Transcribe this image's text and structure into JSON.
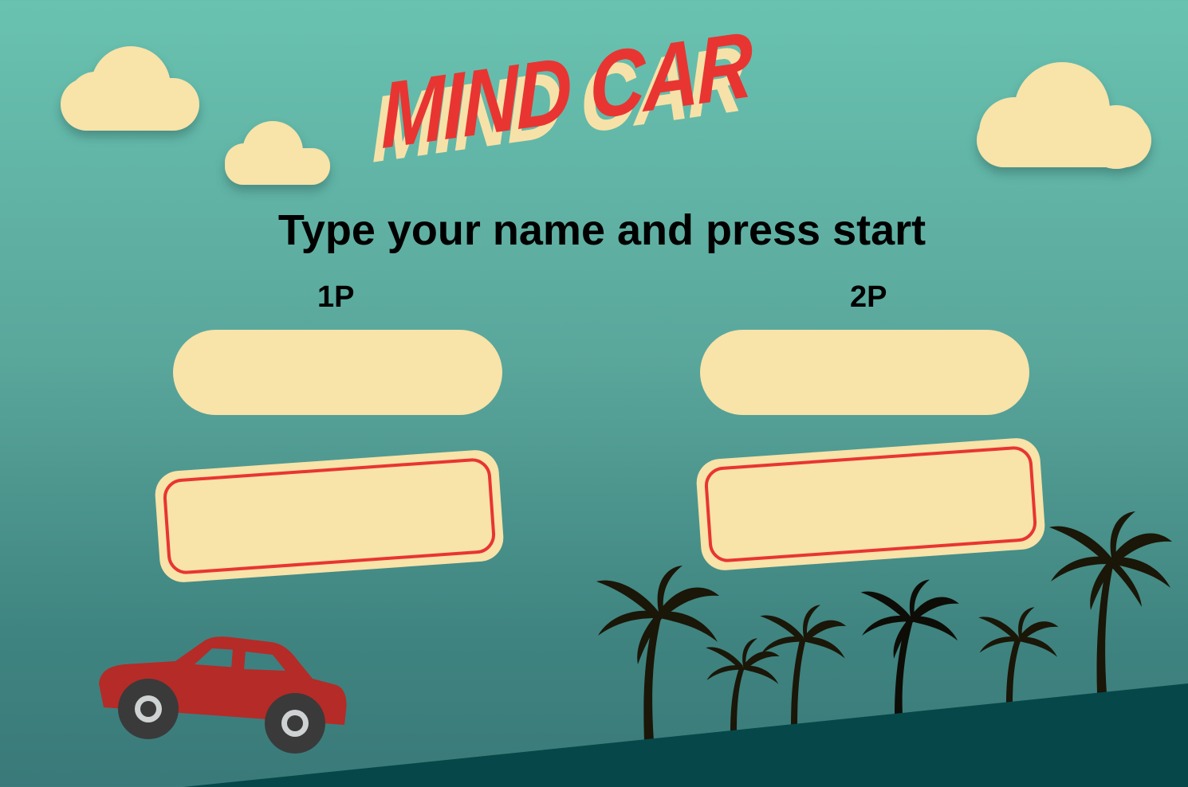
{
  "game": {
    "title": "MIND CAR",
    "instruction": "Type your name and press start"
  },
  "players": [
    {
      "label": "1P",
      "name_value": "",
      "start_label": ""
    },
    {
      "label": "2P",
      "name_value": "",
      "start_label": ""
    }
  ],
  "colors": {
    "sky_top": "#69c2b0",
    "sky_bottom": "#3a7a7a",
    "cloud": "#f8e3a9",
    "title_red": "#e83532",
    "title_shadow": "#f6e2a8",
    "ground": "#06484a",
    "car": "#b52b27",
    "palm": "#1a1608"
  },
  "icons": [
    "cloud-icon",
    "car-icon",
    "palm-tree-icon"
  ]
}
